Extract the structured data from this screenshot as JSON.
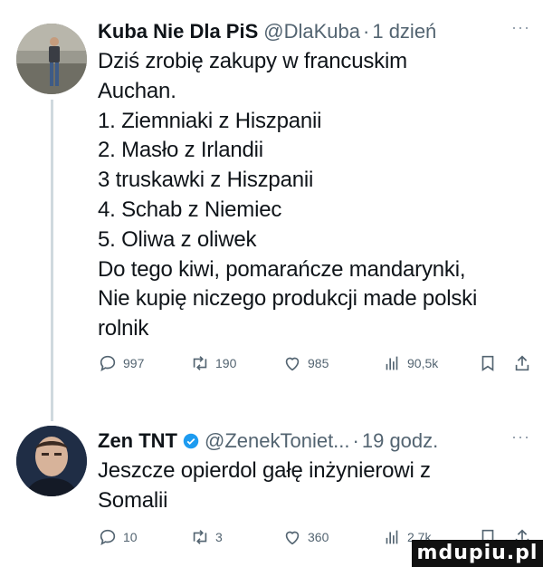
{
  "tweets": [
    {
      "name": "Kuba Nie Dla PiS",
      "handle": "@DlaKuba",
      "separator": "·",
      "time": "1 dzień",
      "more": "···",
      "lines": [
        "Dziś zrobię zakupy w francuskim",
        "Auchan.",
        "1. Ziemniaki z Hiszpanii",
        "2. Masło z Irlandii",
        "3 truskawki z Hiszpanii",
        "4. Schab z Niemiec",
        "5. Oliwa z oliwek",
        "Do tego kiwi, pomarańcze mandarynki,",
        "Nie kupię niczego produkcji made polski",
        "rolnik"
      ],
      "stats": {
        "replies": "997",
        "reposts": "190",
        "likes": "985",
        "views": "90,5k"
      }
    },
    {
      "name": "Zen TNT",
      "verified": true,
      "handle": "@ZenekToniet...",
      "separator": "·",
      "time": "19 godz.",
      "more": "···",
      "lines": [
        "Jeszcze opierdol gałę inżynierowi z",
        "Somalii"
      ],
      "stats": {
        "replies": "10",
        "reposts": "3",
        "likes": "360",
        "views": "2,7k"
      }
    }
  ],
  "colors": {
    "text": "#0f1419",
    "muted": "#536471",
    "verified": "#1d9bf0",
    "thread_line": "#cfd9de"
  },
  "icons": [
    "reply-icon",
    "repost-icon",
    "like-icon",
    "views-icon",
    "bookmark-icon",
    "share-icon",
    "verified-badge-icon"
  ],
  "watermark": "mdupiu.pl"
}
